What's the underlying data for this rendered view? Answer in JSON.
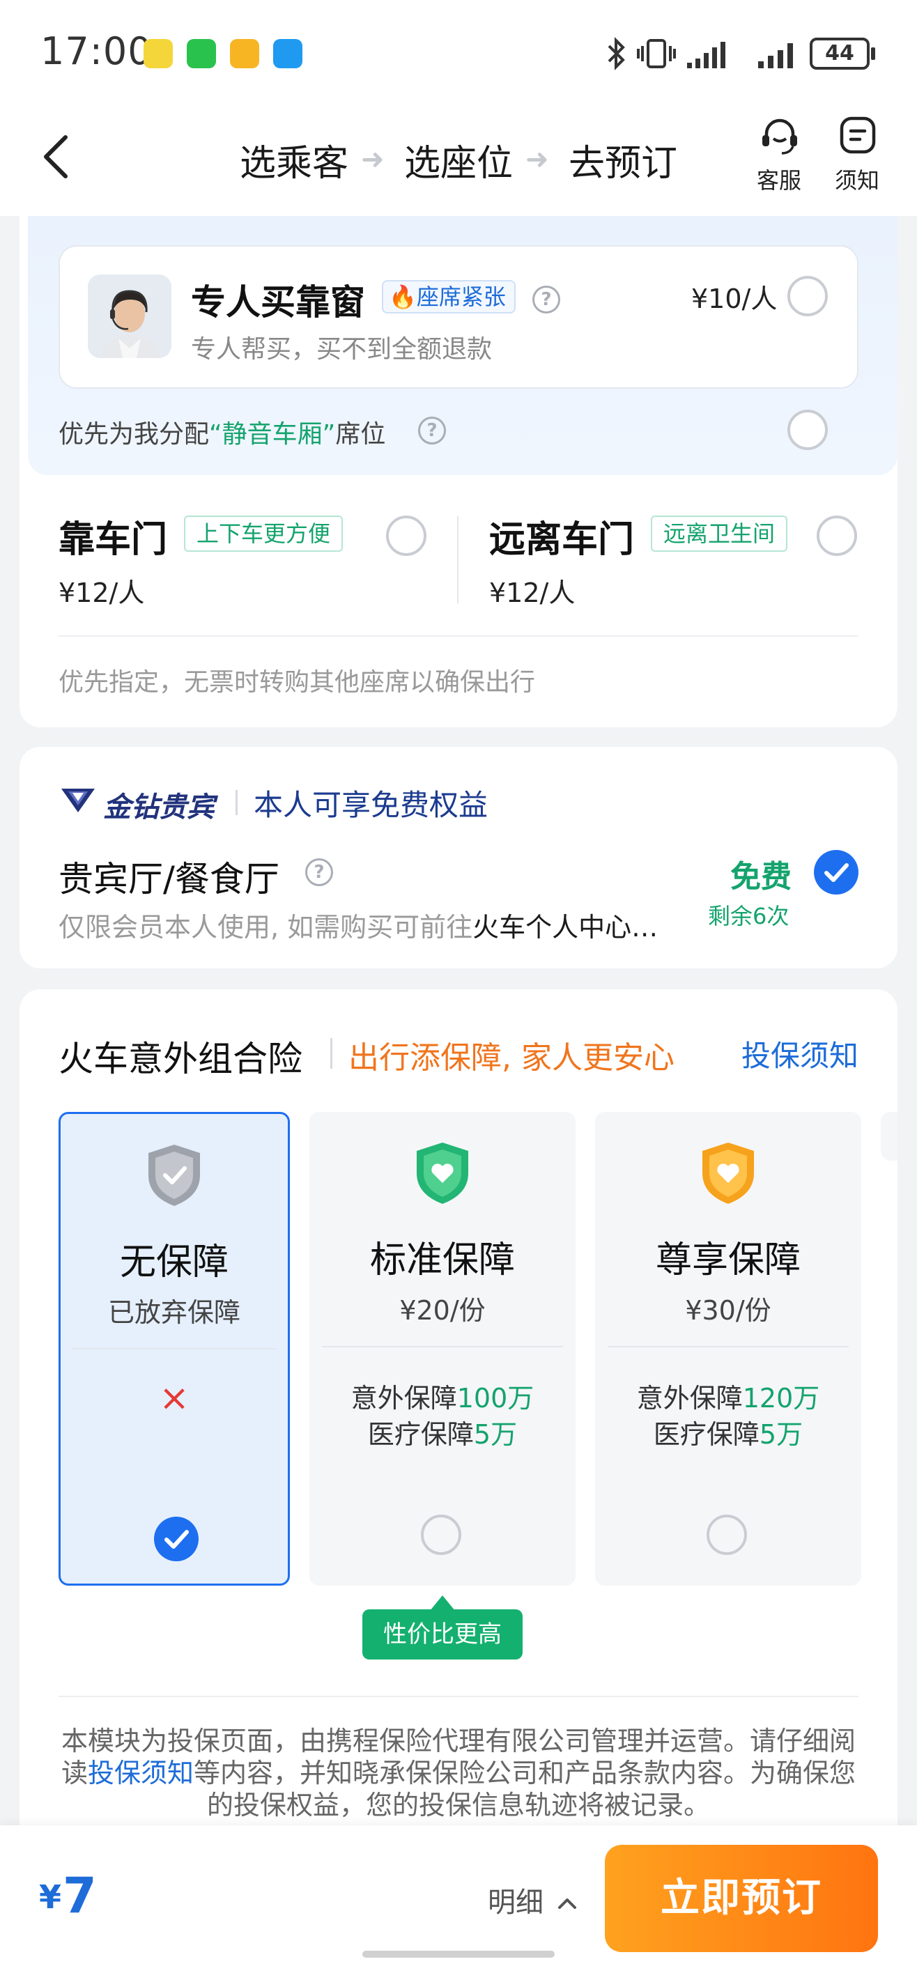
{
  "status_bar": {
    "time": "17:00",
    "battery": "44",
    "app_icons": [
      "cartoon-app-icon",
      "wechat-icon",
      "mail-icon",
      "message-icon"
    ],
    "app_icon_colors": [
      "#f5d63a",
      "#29c24d",
      "#f7b524",
      "#1f9af0"
    ],
    "system_icons": [
      "bluetooth-icon",
      "vibrate-icon",
      "signal-icon",
      "signal-icon",
      "battery-icon"
    ]
  },
  "nav": {
    "steps": [
      "选乘客",
      "选座位",
      "去预订"
    ],
    "service_label": "客服",
    "notice_label": "须知"
  },
  "seat_service": {
    "title": "专人买靠窗",
    "badge": "座席紧张",
    "subtitle": "专人帮买，买不到全额退款",
    "price": "¥10/人",
    "help_mark": "?",
    "quiet_prefix": "优先为我分配",
    "quiet_highlight": "“静音车厢”",
    "quiet_suffix": "席位",
    "door_near": {
      "title": "靠车门",
      "tag": "上下车更方便",
      "price": "¥12/人"
    },
    "door_far": {
      "title": "远离车门",
      "tag": "远离卫生间",
      "price": "¥12/人"
    },
    "note": "优先指定，无票时转购其他座席以确保出行"
  },
  "vip": {
    "brand": "金钻贵宾",
    "benefit": "本人可享免费权益",
    "lounge_title": "贵宾厅/餐食厅",
    "lounge_sub_grey": "仅限会员本人使用, 如需购买可前往",
    "lounge_sub_dark": "火车个人中心…",
    "free_label": "免费",
    "remaining": "剩余6次"
  },
  "insurance": {
    "title": "火车意外组合险",
    "slogan": "出行添保障, 家人更安心",
    "notice_link": "投保须知",
    "plans": [
      {
        "name": "无保障",
        "sub": "已放弃保障",
        "selected": true,
        "mark": "×"
      },
      {
        "name": "标准保障",
        "sub": "¥20/份",
        "cov1_label": "意外保障",
        "cov1_value": "100万",
        "cov2_label": "医疗保障",
        "cov2_value": "5万",
        "selected": false
      },
      {
        "name": "尊享保障",
        "sub": "¥30/份",
        "cov1_label": "意外保障",
        "cov1_value": "120万",
        "cov2_label": "医疗保障",
        "cov2_value": "5万",
        "selected": false
      }
    ],
    "value_tag": "性价比更高",
    "disclaimer_a": "本模块为投保页面，由携程保险代理有限公司管理并运营。请仔细阅读",
    "disclaimer_link": "投保须知",
    "disclaimer_b": "等内容，并知晓承保保险公司和产品条款内容。为确保您的投保权益，您的投保信息轨迹将被记录。"
  },
  "bottom": {
    "currency": "¥",
    "amount": "7",
    "detail": "明细",
    "book": "立即预订"
  },
  "colors": {
    "accent_blue": "#1e6ff0",
    "green": "#14a36d",
    "orange": "#f0751d",
    "button_orange": "#ff8a16"
  }
}
